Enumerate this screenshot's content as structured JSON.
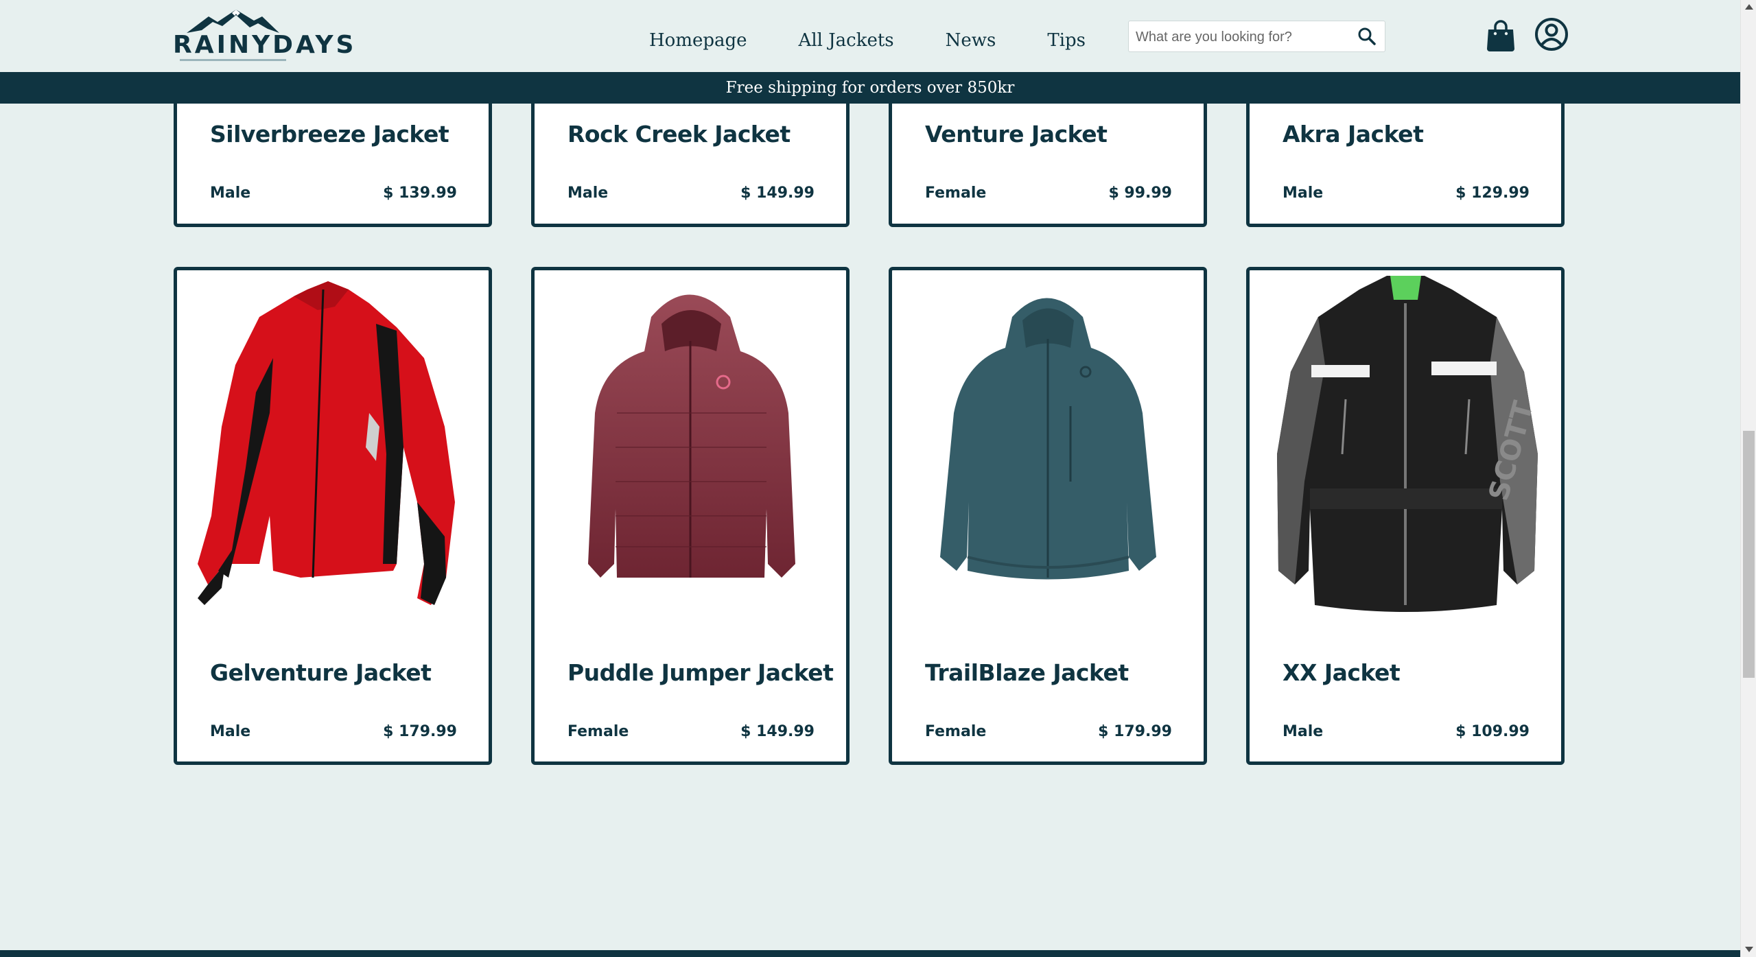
{
  "brand": {
    "name": "RAINYDAYS"
  },
  "nav": {
    "items": [
      {
        "label": "Homepage"
      },
      {
        "label": "All Jackets"
      },
      {
        "label": "News"
      },
      {
        "label": "Tips"
      }
    ]
  },
  "search": {
    "placeholder": "What are you looking for?",
    "value": ""
  },
  "icons": {
    "search": "search-icon",
    "cart": "shopping-bag-icon",
    "account": "user-circle-icon"
  },
  "banner": {
    "text": "Free shipping for orders over 850kr"
  },
  "products": [
    {
      "name": "Silverbreeze Jacket",
      "gender": "Male",
      "price": "$ 139.99"
    },
    {
      "name": "Rock Creek Jacket",
      "gender": "Male",
      "price": "$ 149.99"
    },
    {
      "name": "Venture Jacket",
      "gender": "Female",
      "price": "$ 99.99"
    },
    {
      "name": "Akra Jacket",
      "gender": "Male",
      "price": "$ 129.99"
    },
    {
      "name": "Gelventure Jacket",
      "gender": "Male",
      "price": "$ 179.99"
    },
    {
      "name": "Puddle Jumper Jacket",
      "gender": "Female",
      "price": "$ 149.99"
    },
    {
      "name": "TrailBlaze Jacket",
      "gender": "Female",
      "price": "$ 179.99"
    },
    {
      "name": "XX Jacket",
      "gender": "Male",
      "price": "$ 109.99"
    }
  ],
  "colors": {
    "primary": "#0f3441",
    "background": "#e7f0ef",
    "card": "#ffffff"
  }
}
